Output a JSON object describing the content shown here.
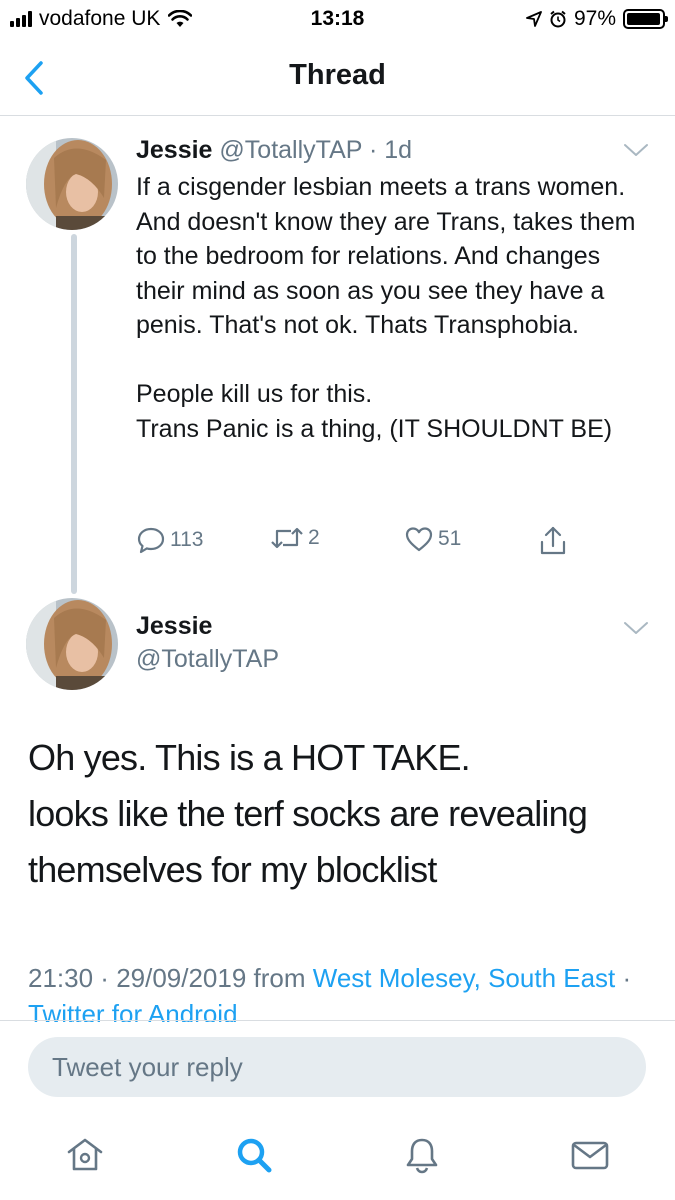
{
  "status_bar": {
    "carrier": "vodafone UK",
    "time": "13:18",
    "battery": "97%",
    "battery_level": 0.97
  },
  "nav": {
    "title": "Thread"
  },
  "tweet1": {
    "name": "Jessie",
    "handle": "@TotallyTAP",
    "separator": "·",
    "age": "1d",
    "text": "If a cisgender lesbian meets a trans women. And doesn't know they are Trans, takes them to the bedroom for relations. And changes their mind as soon as you see they have a penis. That's not ok. Thats Transphobia.\n\nPeople kill us for this.\nTrans Panic is a thing, (IT SHOULDNT BE)",
    "replies": "113",
    "retweets": "2",
    "likes": "51"
  },
  "tweet2": {
    "name": "Jessie",
    "handle": "@TotallyTAP",
    "lines": [
      "Oh yes. This is a HOT TAKE.",
      "looks like the terf socks are revealing",
      "themselves for my blocklist"
    ],
    "time": "21:30",
    "dot": " · ",
    "date": "29/09/2019",
    "from": " from ",
    "location": "West Molesey, South East",
    "client": "Twitter for Android"
  },
  "reply": {
    "placeholder": "Tweet your reply"
  },
  "colors": {
    "accent": "#1da1f2",
    "muted": "#657786",
    "thread_line": "#cdd6de"
  },
  "icons": {
    "tabs": [
      "home-icon",
      "search-icon",
      "notifications-icon",
      "messages-icon"
    ]
  }
}
